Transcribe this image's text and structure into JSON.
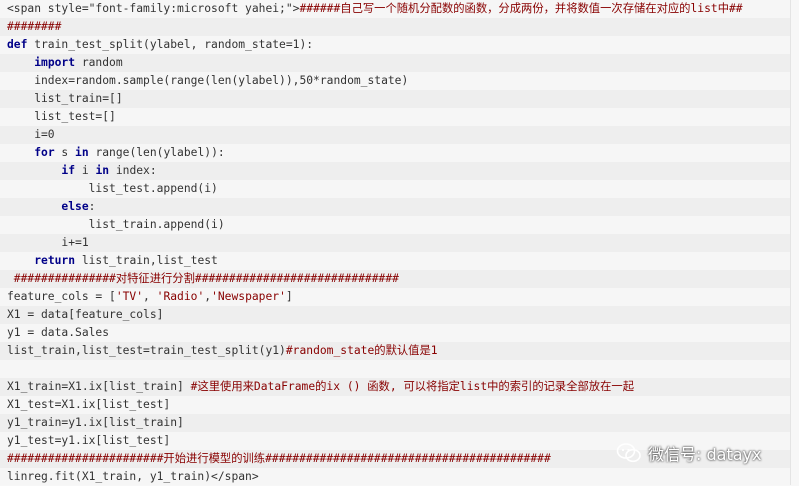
{
  "code_lines": [
    [
      {
        "t": "<span style=\"font-family:microsoft yahei;\">",
        "c": "plain"
      },
      {
        "t": "######自己写一个随机分配数的函数，分成两份，并将数值一次存储在对应的list中##",
        "c": "cmt"
      }
    ],
    [
      {
        "t": "########",
        "c": "cmt"
      }
    ],
    [
      {
        "t": "def",
        "c": "kw"
      },
      {
        "t": " train_test_split(ylabel, random_state=1):",
        "c": "plain"
      }
    ],
    [
      {
        "t": "    ",
        "c": "plain"
      },
      {
        "t": "import",
        "c": "kw"
      },
      {
        "t": " random",
        "c": "plain"
      }
    ],
    [
      {
        "t": "    index=random.sample(range(len(ylabel)),50*random_state)",
        "c": "plain"
      }
    ],
    [
      {
        "t": "    list_train=[]",
        "c": "plain"
      }
    ],
    [
      {
        "t": "    list_test=[]",
        "c": "plain"
      }
    ],
    [
      {
        "t": "    i=0",
        "c": "plain"
      }
    ],
    [
      {
        "t": "    ",
        "c": "plain"
      },
      {
        "t": "for",
        "c": "kw"
      },
      {
        "t": " s ",
        "c": "plain"
      },
      {
        "t": "in",
        "c": "kw"
      },
      {
        "t": " range(len(ylabel)):",
        "c": "plain"
      }
    ],
    [
      {
        "t": "        ",
        "c": "plain"
      },
      {
        "t": "if",
        "c": "kw"
      },
      {
        "t": " i ",
        "c": "plain"
      },
      {
        "t": "in",
        "c": "kw"
      },
      {
        "t": " index:",
        "c": "plain"
      }
    ],
    [
      {
        "t": "            list_test.append(i)",
        "c": "plain"
      }
    ],
    [
      {
        "t": "        ",
        "c": "plain"
      },
      {
        "t": "else",
        "c": "kw"
      },
      {
        "t": ":",
        "c": "plain"
      }
    ],
    [
      {
        "t": "            list_train.append(i)",
        "c": "plain"
      }
    ],
    [
      {
        "t": "        i+=1",
        "c": "plain"
      }
    ],
    [
      {
        "t": "    ",
        "c": "plain"
      },
      {
        "t": "return",
        "c": "kw"
      },
      {
        "t": " list_train,list_test",
        "c": "plain"
      }
    ],
    [
      {
        "t": " ###############对特征进行分割##############################",
        "c": "cmt"
      }
    ],
    [
      {
        "t": "feature_cols = [",
        "c": "plain"
      },
      {
        "t": "'TV'",
        "c": "str"
      },
      {
        "t": ", ",
        "c": "plain"
      },
      {
        "t": "'Radio'",
        "c": "str"
      },
      {
        "t": ",",
        "c": "plain"
      },
      {
        "t": "'Newspaper'",
        "c": "str"
      },
      {
        "t": "]",
        "c": "plain"
      }
    ],
    [
      {
        "t": "X1 = data[feature_cols]",
        "c": "plain"
      }
    ],
    [
      {
        "t": "y1 = data.Sales",
        "c": "plain"
      }
    ],
    [
      {
        "t": "list_train,list_test=train_test_split(y1)",
        "c": "plain"
      },
      {
        "t": "#random_state的默认值是1",
        "c": "cmt"
      }
    ],
    [],
    [
      {
        "t": "X1_train=X1.ix[list_train] ",
        "c": "plain"
      },
      {
        "t": "#这里使用来DataFrame的ix () 函数, 可以将指定list中的索引的记录全部放在一起",
        "c": "cmt"
      }
    ],
    [
      {
        "t": "X1_test=X1.ix[list_test]",
        "c": "plain"
      }
    ],
    [
      {
        "t": "y1_train=y1.ix[list_train]",
        "c": "plain"
      }
    ],
    [
      {
        "t": "y1_test=y1.ix[list_test]",
        "c": "plain"
      }
    ],
    [
      {
        "t": "#######################开始进行模型的训练##########################################",
        "c": "cmt"
      }
    ],
    [
      {
        "t": "linreg.fit(X1_train, y1_train)</span>",
        "c": "plain"
      }
    ]
  ],
  "watermark": {
    "text": "微信号: datayx",
    "icon": "wechat-icon"
  }
}
